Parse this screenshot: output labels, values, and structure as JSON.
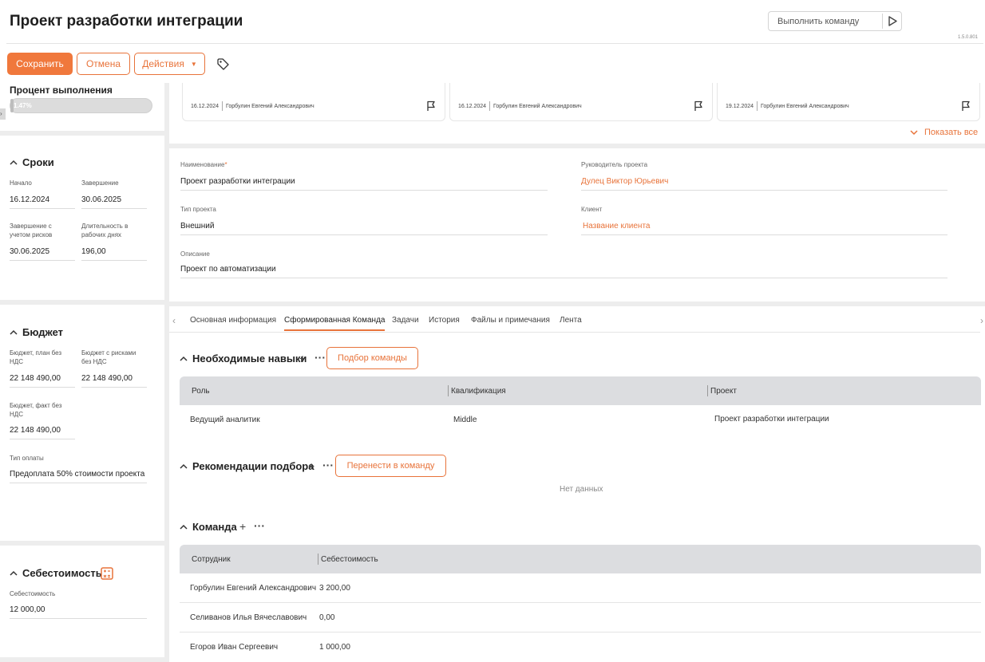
{
  "header": {
    "title": "Проект разработки интеграции",
    "command_placeholder": "Выполнить команду",
    "version": "1.5.0.801"
  },
  "toolbar": {
    "save_label": "Сохранить",
    "cancel_label": "Отмена",
    "actions_label": "Действия"
  },
  "progress": {
    "title": "Процент выполнения",
    "value_text": "1.47%",
    "value": 1.47
  },
  "cards": [
    {
      "date": "16.12.2024",
      "author": "Горбулин Евгений Александрович"
    },
    {
      "date": "16.12.2024",
      "author": "Горбулин Евгений Александрович"
    },
    {
      "date": "19.12.2024",
      "author": "Горбулин Евгений Александрович"
    }
  ],
  "show_all_label": "Показать все",
  "dates": {
    "title": "Сроки",
    "start_label": "Начало",
    "start_value": "16.12.2024",
    "end_label": "Завершение",
    "end_value": "30.06.2025",
    "end_risk_label": "Завершение с учетом рисков",
    "end_risk_value": "30.06.2025",
    "duration_label": "Длительность в рабочих днях",
    "duration_value": "196,00"
  },
  "budget": {
    "title": "Бюджет",
    "plan_label": "Бюджет, план без НДС",
    "plan_value": "22 148 490,00",
    "risk_label": "Бюджет с рисками без НДС",
    "risk_value": "22 148 490,00",
    "fact_label": "Бюджет, факт без НДС",
    "fact_value": "22 148 490,00",
    "payment_label": "Тип оплаты",
    "payment_value": "Предоплата 50% стоимости проекта"
  },
  "cost": {
    "title": "Себестоимость",
    "label": "Себестоимость",
    "value": "12 000,00"
  },
  "details": {
    "name_label": "Наименование",
    "name_value": "Проект разработки интеграции",
    "manager_label": "Руководитель проекта",
    "manager_value": "Дулец Виктор Юрьевич",
    "type_label": "Тип проекта",
    "type_value": "Внешний",
    "client_label": "Клиент",
    "client_value": "Название клиента",
    "desc_label": "Описание",
    "desc_value": "Проект по автоматизации"
  },
  "tabs": [
    {
      "label": "Основная информация"
    },
    {
      "label": "Сформированная Команда"
    },
    {
      "label": "Задачи"
    },
    {
      "label": "История"
    },
    {
      "label": "Файлы и примечания"
    },
    {
      "label": "Лента"
    }
  ],
  "skills": {
    "title": "Необходимые навыки",
    "button": "Подбор команды",
    "columns": [
      "Роль",
      "Квалификация",
      "Проект"
    ],
    "rows": [
      {
        "role": "Ведущий аналитик",
        "qualification": "Middle",
        "project": "Проект разработки интеграции"
      }
    ]
  },
  "recommendations": {
    "title": "Рекомендации подбора",
    "button": "Перенести в команду",
    "empty": "Нет данных"
  },
  "team": {
    "title": "Команда",
    "columns": [
      "Сотрудник",
      "Себестоимость"
    ],
    "rows": [
      {
        "employee": "Горбулин Евгений Александрович",
        "cost": "3 200,00"
      },
      {
        "employee": "Селиванов Илья Вячеславович",
        "cost": "0,00"
      },
      {
        "employee": "Егоров Иван Сергеевич",
        "cost": "1 000,00"
      }
    ]
  },
  "colors": {
    "accent": "#f0783c",
    "link": "#e8733a"
  }
}
